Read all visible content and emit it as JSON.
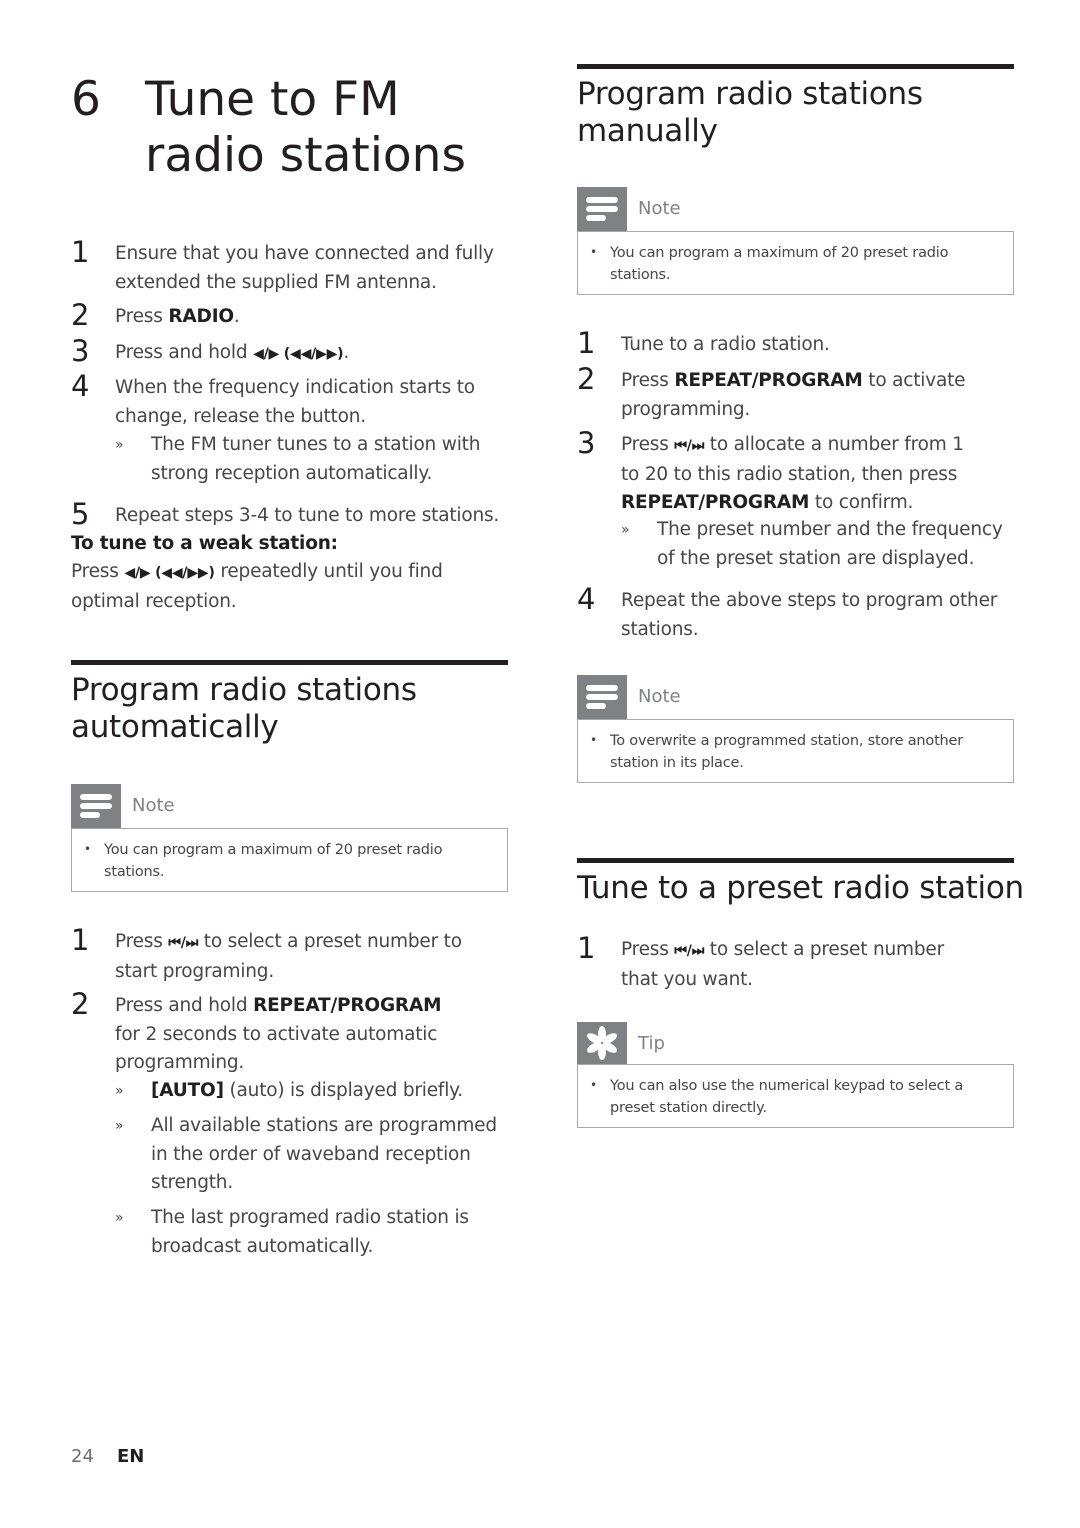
{
  "chapter": {
    "number": "6",
    "title": "Tune to FM radio stations"
  },
  "intro_steps": [
    {
      "n": "1",
      "text": "Ensure that you have connected and fully extended the supplied FM antenna."
    },
    {
      "n": "2",
      "pre": "Press ",
      "bold": "RADIO",
      "post": "."
    },
    {
      "n": "3",
      "pre": "Press and hold ",
      "symbols": "◀/▶ (◀◀/▶▶)",
      "post": "."
    },
    {
      "n": "4",
      "text": "When the frequency indication starts to change, release the button."
    },
    {
      "n": "5",
      "text": "Repeat steps 3-4 to tune to more stations."
    }
  ],
  "intro_result": "The FM tuner tunes to a station with strong reception automatically.",
  "weak_station": {
    "heading": "To tune to a weak station:",
    "pre": "Press ",
    "symbols": "◀/▶ (◀◀/▶▶)",
    "post": " repeatedly until you find optimal reception."
  },
  "auto_section": {
    "title": "Program radio stations automatically",
    "note_label": "Note",
    "note_text": "You can program a maximum of 20 preset radio stations.",
    "steps": [
      {
        "n": "1",
        "pre": "Press ",
        "symbols": "⏮/⏭",
        "post": " to select a preset number to start programing."
      },
      {
        "n": "2",
        "pre": "Press and hold ",
        "bold": "REPEAT/PROGRAM",
        "post": " for 2 seconds to activate automatic programming."
      }
    ],
    "results": [
      {
        "bold": "[AUTO]",
        "text": " (auto) is displayed briefly."
      },
      {
        "text": "All available stations are programmed in the order of waveband reception strength."
      },
      {
        "text": "The last programed radio station is broadcast automatically."
      }
    ]
  },
  "manual_section": {
    "title": "Program radio stations manually",
    "note_label": "Note",
    "note_text": "You can program a maximum of 20 preset radio stations.",
    "steps": [
      {
        "n": "1",
        "text": "Tune to a radio station."
      },
      {
        "n": "2",
        "pre": "Press ",
        "bold": "REPEAT/PROGRAM",
        "post": " to activate programming."
      },
      {
        "n": "3",
        "pre": "Press ",
        "symbols": "⏮/⏭",
        "mid": " to allocate a number from 1 to 20 to this radio station, then press ",
        "bold": "REPEAT/PROGRAM",
        "post": " to confirm."
      },
      {
        "n": "4",
        "text": "Repeat the above steps to program other stations."
      }
    ],
    "result": "The preset number and the frequency of the preset station are displayed.",
    "note2_label": "Note",
    "note2_text": "To overwrite a programmed station, store another station in its place."
  },
  "preset_section": {
    "title": "Tune to a preset radio station",
    "steps": [
      {
        "n": "1",
        "pre": "Press ",
        "symbols": "⏮/⏭",
        "post": " to select a preset number that you want."
      }
    ],
    "tip_label": "Tip",
    "tip_text": "You can also use the numerical keypad to select a preset station directly."
  },
  "footer": {
    "page_number": "24",
    "language": "EN"
  },
  "icons": {
    "note": "note-lines-icon",
    "tip": "tip-asterisk-icon",
    "result_marker": "»",
    "bullet": "•"
  },
  "colors": {
    "heading": "#231f20",
    "body": "#4a4445",
    "icon_bg": "#808184",
    "box_border": "#a7a9ac"
  }
}
